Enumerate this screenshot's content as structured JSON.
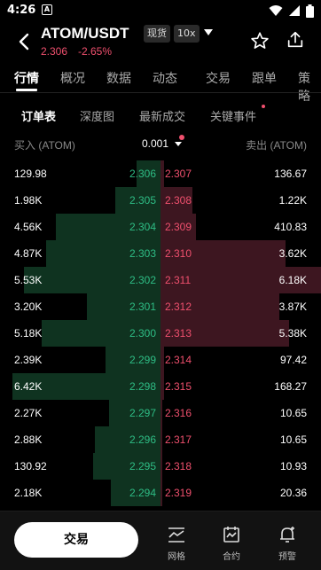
{
  "status": {
    "time": "4:26",
    "notif_letter": "A"
  },
  "header": {
    "pair": "ATOM/USDT",
    "market_badge": "现货",
    "leverage_badge": "10x",
    "last_price": "2.306",
    "change_pct": "-2.65%"
  },
  "main_tabs": [
    "行情",
    "概况",
    "数据",
    "动态",
    "交易",
    "跟单",
    "策略"
  ],
  "sub_tabs": [
    "订单表",
    "深度图",
    "最新成交",
    "关键事件"
  ],
  "columns": {
    "bid_label": "买入 (ATOM)",
    "step": "0.001",
    "ask_label": "卖出 (ATOM)"
  },
  "orderbook": [
    {
      "bid_qty": "129.98",
      "bid_price": "2.306",
      "ask_price": "2.307",
      "ask_qty": "136.67",
      "bid_depth": 0.15,
      "ask_depth": 0.02
    },
    {
      "bid_qty": "1.98K",
      "bid_price": "2.305",
      "ask_price": "2.308",
      "ask_qty": "1.22K",
      "bid_depth": 0.28,
      "ask_depth": 0.2
    },
    {
      "bid_qty": "4.56K",
      "bid_price": "2.304",
      "ask_price": "2.309",
      "ask_qty": "410.83",
      "bid_depth": 0.65,
      "ask_depth": 0.22
    },
    {
      "bid_qty": "4.87K",
      "bid_price": "2.303",
      "ask_price": "2.310",
      "ask_qty": "3.62K",
      "bid_depth": 0.71,
      "ask_depth": 0.78
    },
    {
      "bid_qty": "5.53K",
      "bid_price": "2.302",
      "ask_price": "2.311",
      "ask_qty": "6.18K",
      "bid_depth": 0.85,
      "ask_depth": 1.0
    },
    {
      "bid_qty": "3.20K",
      "bid_price": "2.301",
      "ask_price": "2.312",
      "ask_qty": "3.87K",
      "bid_depth": 0.46,
      "ask_depth": 0.74
    },
    {
      "bid_qty": "5.18K",
      "bid_price": "2.300",
      "ask_price": "2.313",
      "ask_qty": "5.38K",
      "bid_depth": 0.74,
      "ask_depth": 0.8
    },
    {
      "bid_qty": "2.39K",
      "bid_price": "2.299",
      "ask_price": "2.314",
      "ask_qty": "97.42",
      "bid_depth": 0.34,
      "ask_depth": 0.02
    },
    {
      "bid_qty": "6.42K",
      "bid_price": "2.298",
      "ask_price": "2.315",
      "ask_qty": "168.27",
      "bid_depth": 0.92,
      "ask_depth": 0.02
    },
    {
      "bid_qty": "2.27K",
      "bid_price": "2.297",
      "ask_price": "2.316",
      "ask_qty": "10.65",
      "bid_depth": 0.32,
      "ask_depth": 0.01
    },
    {
      "bid_qty": "2.88K",
      "bid_price": "2.296",
      "ask_price": "2.317",
      "ask_qty": "10.65",
      "bid_depth": 0.41,
      "ask_depth": 0.01
    },
    {
      "bid_qty": "130.92",
      "bid_price": "2.295",
      "ask_price": "2.318",
      "ask_qty": "10.93",
      "bid_depth": 0.42,
      "ask_depth": 0.01
    },
    {
      "bid_qty": "2.18K",
      "bid_price": "2.294",
      "ask_price": "2.319",
      "ask_qty": "20.36",
      "bid_depth": 0.31,
      "ask_depth": 0.01
    }
  ],
  "bottom": {
    "trade_label": "交易",
    "nav": [
      {
        "label": "网格",
        "icon": "grid-chart-icon"
      },
      {
        "label": "合约",
        "icon": "contract-icon"
      },
      {
        "label": "预警",
        "icon": "alert-bell-icon"
      }
    ]
  },
  "colors": {
    "bid": "#2ebd85",
    "ask": "#f0506e",
    "bid_bar": "#0f3320",
    "ask_bar": "#3d1620"
  }
}
